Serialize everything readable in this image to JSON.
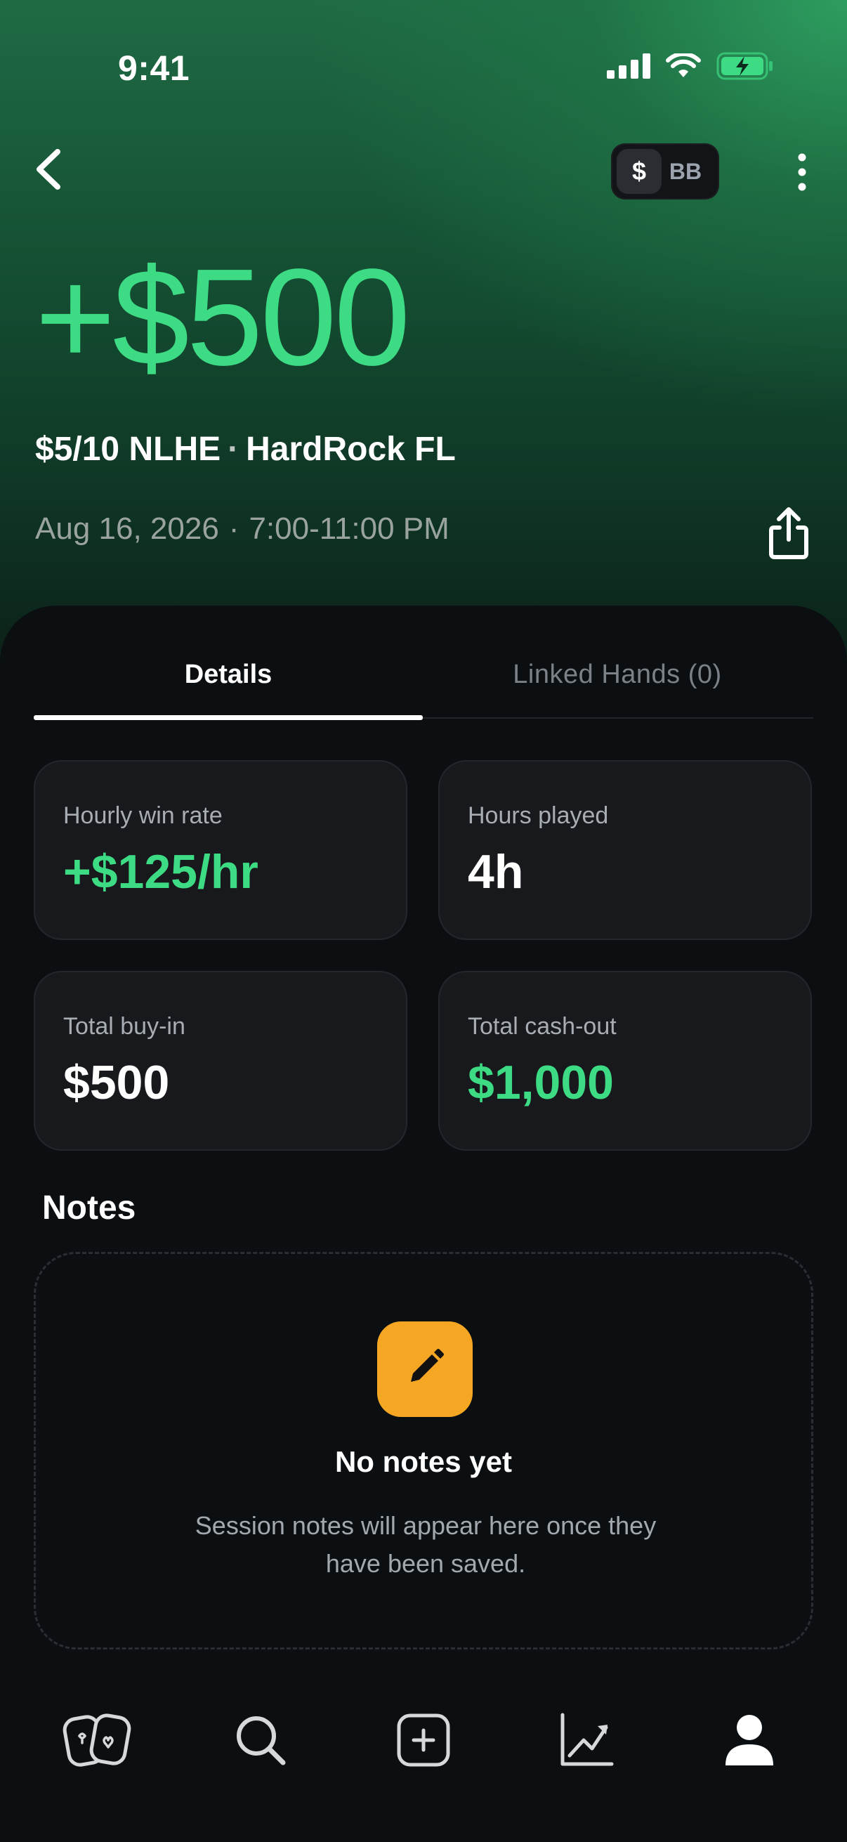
{
  "status_bar": {
    "time": "9:41",
    "icons": [
      "signal-icon",
      "wifi-icon",
      "battery-charging-icon"
    ]
  },
  "header": {
    "back_icon": "chevron-left-icon",
    "unit_toggle": {
      "options": [
        "$",
        "BB"
      ],
      "selected": "$"
    },
    "menu_icon": "more-vertical-icon"
  },
  "session": {
    "profit": "+$500",
    "stakes": "$5/10 NLHE",
    "separator": "·",
    "venue": "HardRock FL",
    "date": "Aug 16, 2026",
    "time_range": "7:00-11:00 PM",
    "share_icon": "share-icon"
  },
  "tabs": [
    {
      "label": "Details",
      "active": true
    },
    {
      "label": "Linked Hands (0)",
      "active": false
    }
  ],
  "stats": [
    {
      "label": "Hourly win rate",
      "value": "+$125/hr",
      "highlight": true
    },
    {
      "label": "Hours played",
      "value": "4h",
      "highlight": false
    },
    {
      "label": "Total buy-in",
      "value": "$500",
      "highlight": false
    },
    {
      "label": "Total cash-out",
      "value": "$1,000",
      "highlight": true
    }
  ],
  "notes": {
    "title": "Notes",
    "empty_icon": "pencil-icon",
    "empty_title": "No notes yet",
    "empty_body": "Session notes will appear here once they have been saved."
  },
  "bottom_nav": [
    {
      "icon": "cards-icon"
    },
    {
      "icon": "search-icon"
    },
    {
      "icon": "add-square-icon"
    },
    {
      "icon": "chart-trend-icon"
    },
    {
      "icon": "profile-icon"
    }
  ],
  "colors": {
    "accent_green": "#3ddc84",
    "notes_orange": "#f5a623",
    "background": "#0c0f12",
    "card": "#17191d"
  }
}
